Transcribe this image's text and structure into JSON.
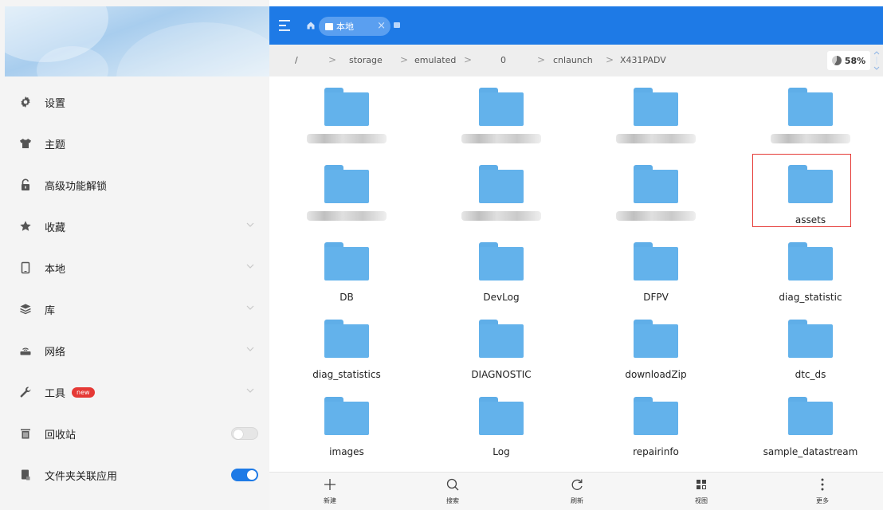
{
  "sidebar": {
    "items": [
      {
        "name": "sidebar-item-settings",
        "icon": "gear-icon",
        "label": "设置"
      },
      {
        "name": "sidebar-item-theme",
        "icon": "shirt-icon",
        "label": "主题"
      },
      {
        "name": "sidebar-item-unlock",
        "icon": "unlock-icon",
        "label": "高级功能解锁"
      },
      {
        "name": "sidebar-item-favorites",
        "icon": "star-icon",
        "label": "收藏"
      },
      {
        "name": "sidebar-item-local",
        "icon": "phone-icon",
        "label": "本地"
      },
      {
        "name": "sidebar-item-library",
        "icon": "layers-icon",
        "label": "库"
      },
      {
        "name": "sidebar-item-network",
        "icon": "router-icon",
        "label": "网络"
      },
      {
        "name": "sidebar-item-tools",
        "icon": "wrench-icon",
        "label": "工具",
        "badge": "new"
      },
      {
        "name": "sidebar-item-recycle-bin",
        "icon": "trash-icon",
        "label": "回收站",
        "toggle": false
      },
      {
        "name": "sidebar-item-folder-apps",
        "icon": "folder-app-icon",
        "label": "文件夹关联应用",
        "toggle": true
      }
    ]
  },
  "topbar": {
    "tab_label": "本地"
  },
  "breadcrumb": {
    "root": "/",
    "parts": [
      "storage",
      "emulated",
      "0",
      "cnlaunch",
      "X431PADV"
    ]
  },
  "storage": {
    "percent_label": "58%",
    "fraction": 0.58
  },
  "folders": [
    {
      "label": "",
      "blurred": true
    },
    {
      "label": "",
      "blurred": true
    },
    {
      "label": "",
      "blurred": true
    },
    {
      "label": "",
      "blurred": true
    },
    {
      "label": "",
      "blurred": true
    },
    {
      "label": "",
      "blurred": true
    },
    {
      "label": "",
      "blurred": true
    },
    {
      "label": "assets",
      "highlighted": true
    },
    {
      "label": "DB"
    },
    {
      "label": "DevLog"
    },
    {
      "label": "DFPV"
    },
    {
      "label": "diag_statistic"
    },
    {
      "label": "diag_statistics"
    },
    {
      "label": "DIAGNOSTIC"
    },
    {
      "label": "downloadZip"
    },
    {
      "label": "dtc_ds"
    },
    {
      "label": "images"
    },
    {
      "label": "Log"
    },
    {
      "label": "repairinfo"
    },
    {
      "label": "sample_datastream"
    }
  ],
  "bottombar": {
    "new_label": "新建",
    "search_label": "搜索",
    "refresh_label": "刷新",
    "view_label": "视图",
    "more_label": "更多"
  },
  "colors": {
    "accent": "#1e7ae6",
    "folder": "#63b2eb",
    "highlight": "#e53935"
  }
}
